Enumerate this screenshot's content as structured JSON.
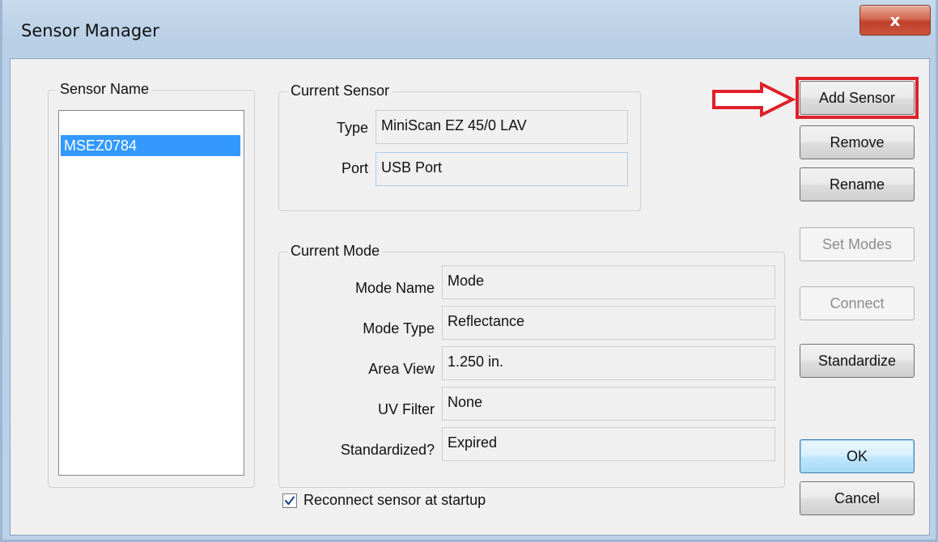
{
  "window": {
    "title": "Sensor Manager",
    "close_glyph": "x"
  },
  "sensor_list": {
    "group_title": "Sensor Name",
    "items": [
      {
        "label": "MSEZ0784",
        "selected": true
      }
    ]
  },
  "current_sensor": {
    "group_title": "Current Sensor",
    "type_label": "Type",
    "type_value": "MiniScan EZ 45/0 LAV",
    "port_label": "Port",
    "port_value": "USB Port"
  },
  "current_mode": {
    "group_title": "Current Mode",
    "fields": [
      {
        "label": "Mode Name",
        "value": "Mode"
      },
      {
        "label": "Mode Type",
        "value": "Reflectance"
      },
      {
        "label": "Area View",
        "value": "1.250 in."
      },
      {
        "label": "UV Filter",
        "value": "None"
      },
      {
        "label": "Standardized?",
        "value": "Expired"
      }
    ]
  },
  "buttons": {
    "add_sensor": "Add Sensor",
    "remove": "Remove",
    "rename": "Rename",
    "set_modes": "Set Modes",
    "connect": "Connect",
    "standardize": "Standardize",
    "ok": "OK",
    "cancel": "Cancel"
  },
  "reconnect": {
    "label": "Reconnect sensor at startup",
    "checked": true
  },
  "annotation": {
    "highlight_color": "#e0202a"
  },
  "icons": {
    "close": "close-icon",
    "arrow": "arrow-right-icon",
    "check": "checkmark-icon"
  }
}
